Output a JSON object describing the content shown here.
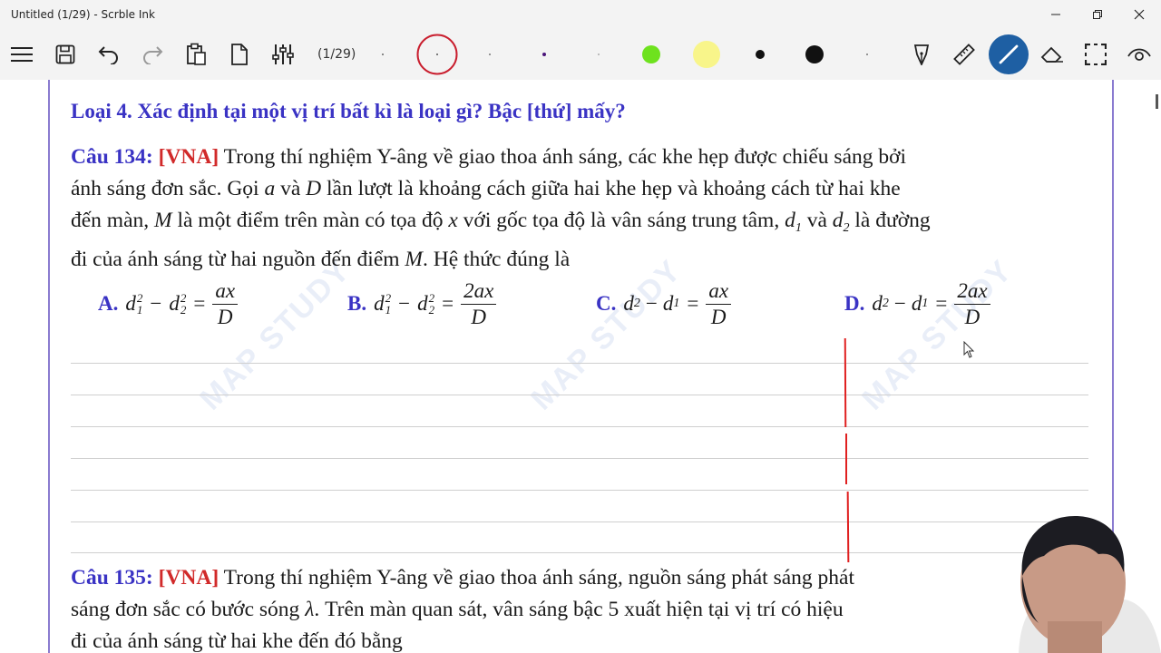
{
  "window": {
    "title": "Untitled (1/29) - Scrble Ink"
  },
  "toolbar": {
    "page_indicator": "(1/29)",
    "colors": {
      "green": "#6ee21e",
      "yellow": "#f8f58a",
      "black": "#111111",
      "ring": "#c91e2e",
      "pen_active": "#1e5fa3"
    }
  },
  "document": {
    "heading": "Loại 4. Xác định tại một vị trí bất kì là loại gì? Bậc [thứ] mấy?",
    "q134": {
      "label": "Câu 134:",
      "tag": "[VNA]",
      "line1_rest": " Trong thí nghiệm Y-âng về giao thoa ánh sáng, các khe hẹp được chiếu sáng bởi",
      "line2_a": "ánh sáng đơn sắc. Gọi ",
      "var_a": "a",
      "line2_b": " và ",
      "var_D": "D",
      "line2_c": " lần lượt là khoảng cách giữa hai khe hẹp và khoảng cách từ hai khe",
      "line3_a": "đến màn, ",
      "var_M": "M",
      "line3_b": " là một điểm trên màn có tọa độ ",
      "var_x": "x",
      "line3_c": " với gốc tọa độ là vân sáng trung tâm, ",
      "var_d": "d",
      "sub_1": "1",
      "line3_d": " và ",
      "sub_2": "2",
      "line3_e": " là đường",
      "line4_a": "đi của ánh sáng từ hai nguồn đến điểm ",
      "line4_b": ". Hệ thức đúng là"
    },
    "options": {
      "A": {
        "letter": "A.",
        "num": "ax",
        "den": "D"
      },
      "B": {
        "letter": "B.",
        "num": "2ax",
        "den": "D"
      },
      "C": {
        "letter": "C.",
        "num": "ax",
        "den": "D"
      },
      "D": {
        "letter": "D.",
        "num": "2ax",
        "den": "D"
      },
      "minus": "−",
      "equals": "=",
      "sup2": "2"
    },
    "q135": {
      "label": "Câu 135:",
      "tag": "[VNA]",
      "line1_rest": " Trong thí nghiệm Y-âng về giao thoa ánh sáng, nguồn sáng phát sáng phát",
      "line2_a": "sáng đơn sắc có bước sóng ",
      "var_lambda": "λ",
      "line2_b": ". Trên màn quan sát, vân sáng bậc 5 xuất hiện tại vị trí có hiệu",
      "line3": "đi của ánh sáng từ hai khe đến đó bằng"
    },
    "watermark": "MAP STUDY"
  }
}
